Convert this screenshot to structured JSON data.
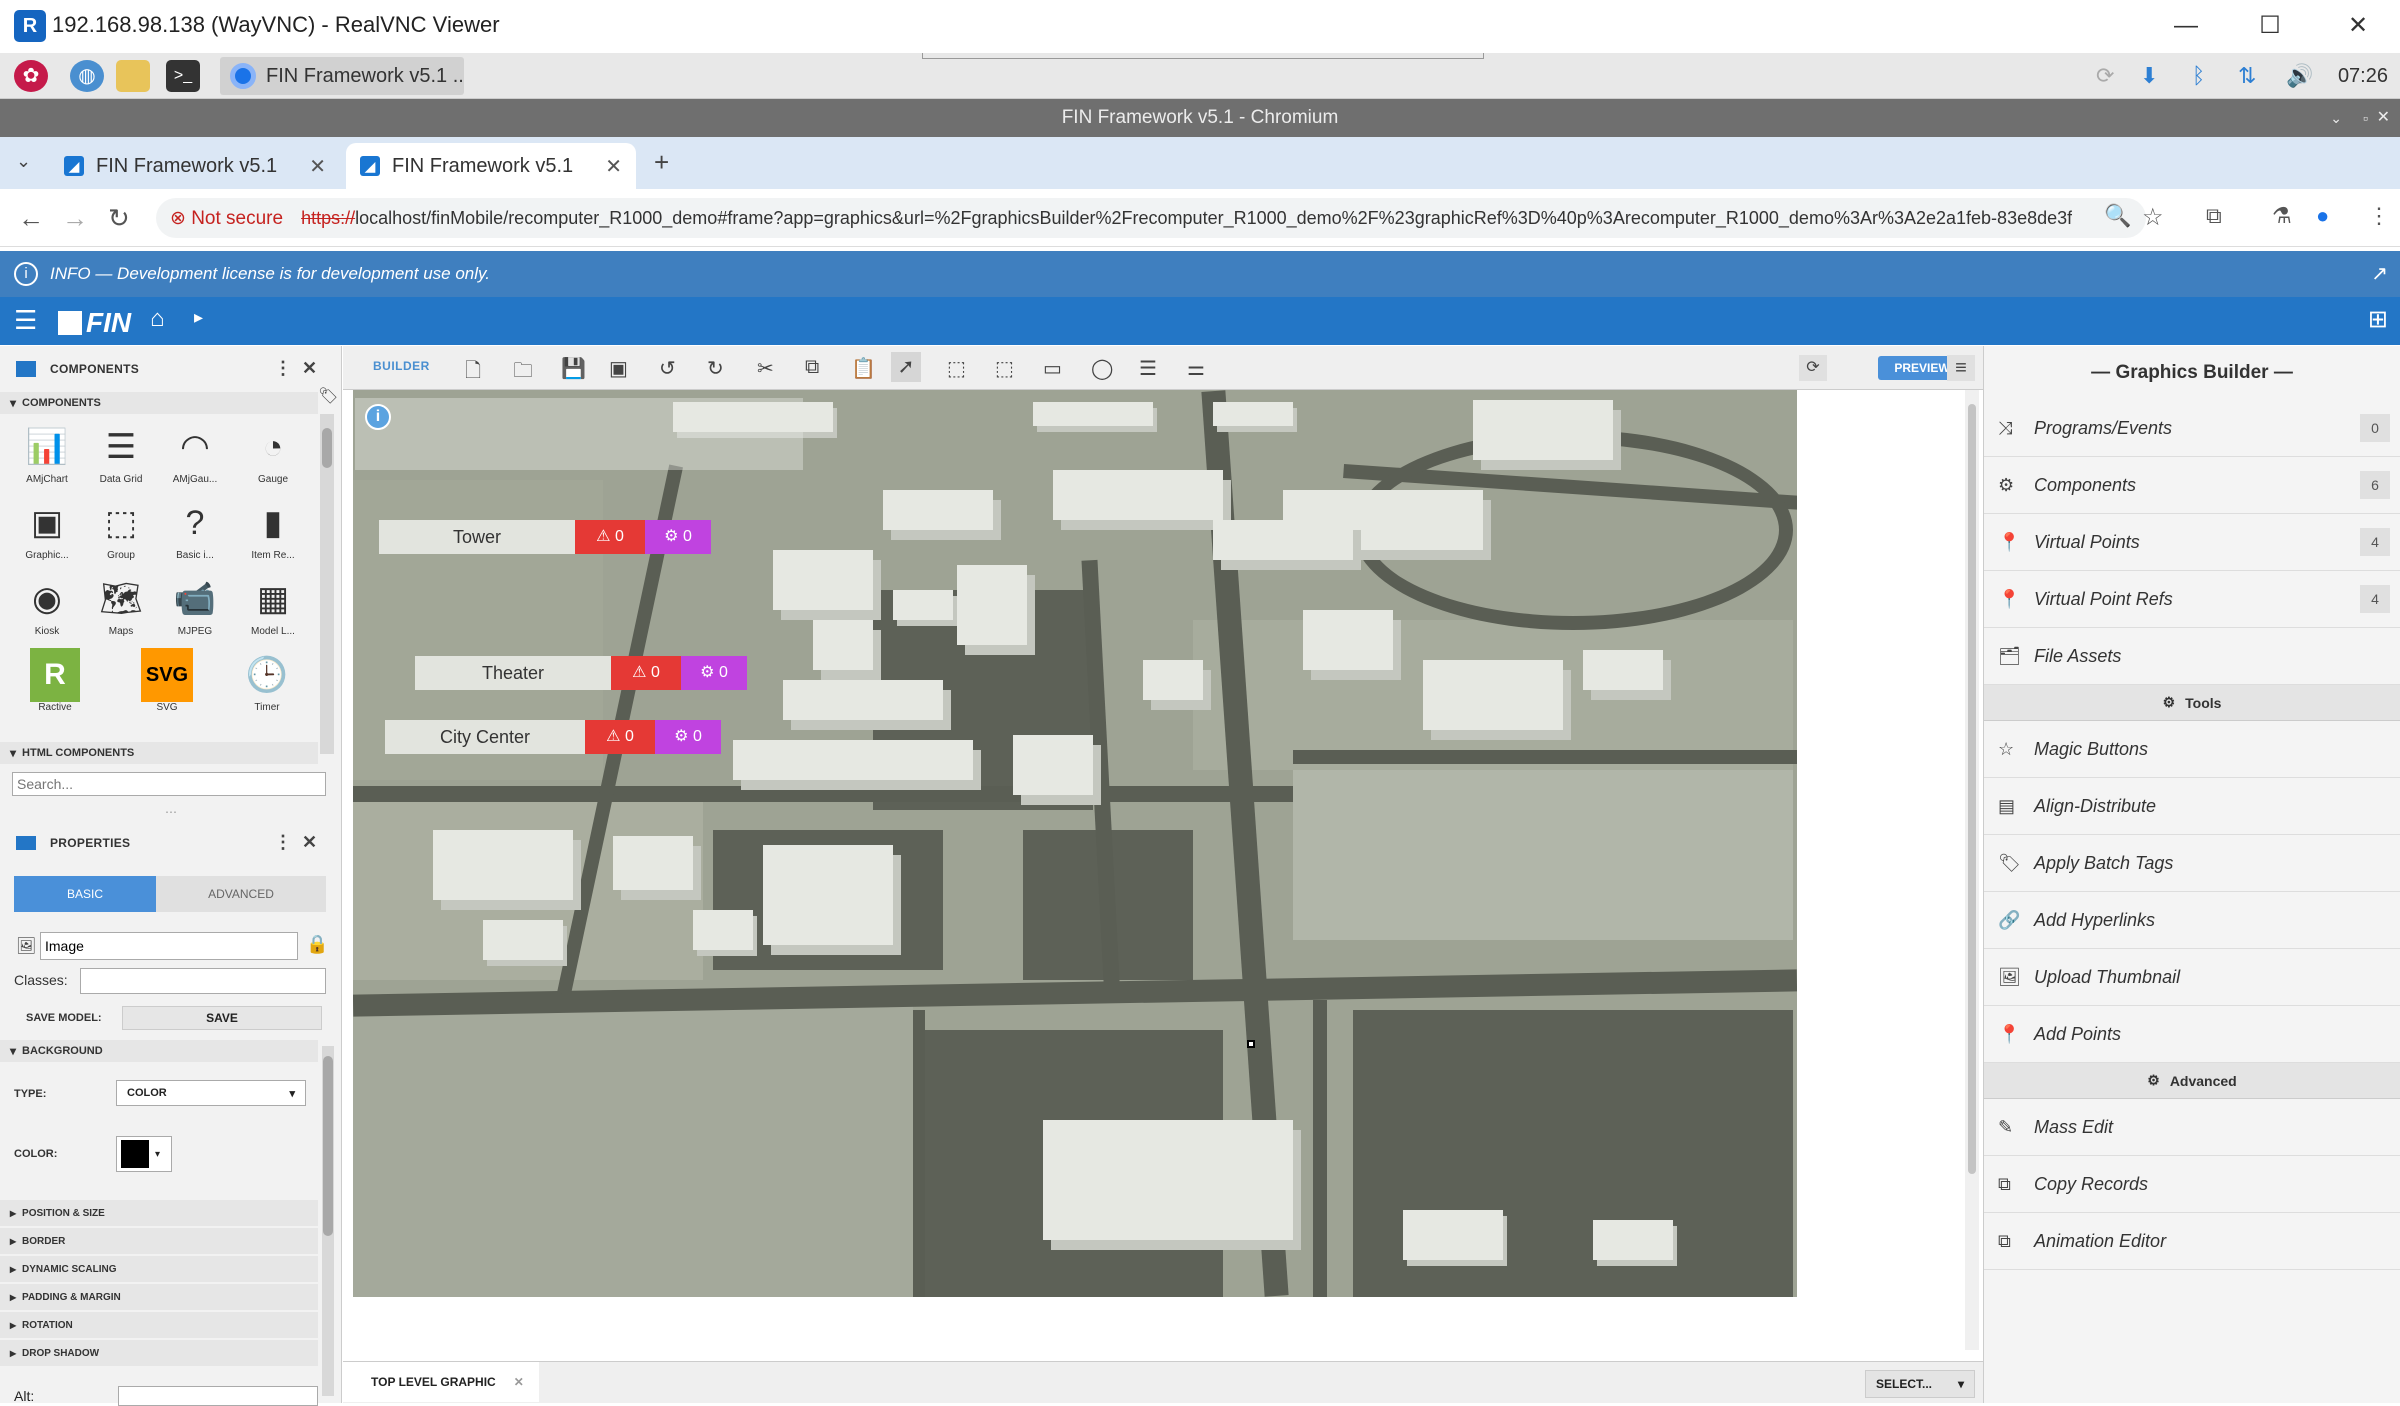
{
  "vnc": {
    "title": "192.168.98.138 (WayVNC) - RealVNC Viewer",
    "logo": "R"
  },
  "taskbar": {
    "task_label": "FIN Framework v5.1 ..",
    "clock": "07:26"
  },
  "chromium": {
    "window_title": "FIN Framework v5.1 - Chromium"
  },
  "tabs": [
    {
      "label": "FIN Framework v5.1"
    },
    {
      "label": "FIN Framework v5.1"
    }
  ],
  "address": {
    "not_secure": "Not secure",
    "scheme": "https://",
    "url": "localhost/finMobile/recomputer_R1000_demo#frame?app=graphics&url=%2FgraphicsBuilder%2Frecomputer_R1000_demo%2F%23graphicRef%3D%40p%3Arecomputer_R1000_demo%3Ar%3A2e2a1feb-83e8de3f"
  },
  "info": {
    "text": "INFO — Development license is for development use only."
  },
  "app": {
    "logo": "FIN"
  },
  "components_panel": {
    "title": "COMPONENTS",
    "section": "COMPONENTS",
    "html_section": "HTML COMPONENTS",
    "search_placeholder": "Search...",
    "items": [
      {
        "label": "AMjChart",
        "glyph": "📊"
      },
      {
        "label": "Data Grid",
        "glyph": "☰"
      },
      {
        "label": "AMjGau...",
        "glyph": "◠"
      },
      {
        "label": "Gauge",
        "glyph": "◔"
      },
      {
        "label": "Graphic...",
        "glyph": "▣"
      },
      {
        "label": "Group",
        "glyph": "⬚"
      },
      {
        "label": "Basic i...",
        "glyph": "?"
      },
      {
        "label": "Item Re...",
        "glyph": "▮"
      },
      {
        "label": "Kiosk",
        "glyph": "◉"
      },
      {
        "label": "Maps",
        "glyph": "🗺"
      },
      {
        "label": "MJPEG",
        "glyph": "📹"
      },
      {
        "label": "Model L...",
        "glyph": "▦"
      },
      {
        "label": "Ractive",
        "glyph": "R"
      },
      {
        "label": "SVG",
        "glyph": "SVG"
      },
      {
        "label": "Timer",
        "glyph": "🕒"
      }
    ]
  },
  "properties_panel": {
    "title": "PROPERTIES",
    "tab_basic": "BASIC",
    "tab_advanced": "ADVANCED",
    "name_value": "Image",
    "classes_label": "Classes:",
    "save_model_label": "SAVE MODEL:",
    "save_button": "SAVE",
    "background_section": "BACKGROUND",
    "type_label": "TYPE:",
    "type_value": "COLOR",
    "color_label": "COLOR:",
    "color_value": "#000000",
    "sections": [
      "POSITION & SIZE",
      "BORDER",
      "DYNAMIC SCALING",
      "PADDING & MARGIN",
      "ROTATION",
      "DROP SHADOW"
    ],
    "alt_label": "Alt:"
  },
  "builder": {
    "label": "BUILDER",
    "preview": "PREVIEW"
  },
  "map": {
    "locations": [
      {
        "name": "Tower",
        "alarms": "0",
        "points": "0"
      },
      {
        "name": "Theater",
        "alarms": "0",
        "points": "0"
      },
      {
        "name": "City Center",
        "alarms": "0",
        "points": "0"
      }
    ]
  },
  "bottom": {
    "tab": "TOP LEVEL GRAPHIC",
    "select": "SELECT..."
  },
  "graphics_builder": {
    "title": "— Graphics Builder —",
    "items": [
      {
        "label": "Programs/Events",
        "icon": "⤨",
        "count": "0"
      },
      {
        "label": "Components",
        "icon": "⚙",
        "count": "6"
      },
      {
        "label": "Virtual Points",
        "icon": "📍",
        "count": "4"
      },
      {
        "label": "Virtual Point Refs",
        "icon": "📍",
        "count": "4"
      },
      {
        "label": "File Assets",
        "icon": "🗂",
        "count": ""
      }
    ],
    "tools_section": "Tools",
    "tools": [
      {
        "label": "Magic Buttons",
        "icon": "☆"
      },
      {
        "label": "Align-Distribute",
        "icon": "▤"
      },
      {
        "label": "Apply Batch Tags",
        "icon": "🏷"
      },
      {
        "label": "Add Hyperlinks",
        "icon": "🔗"
      },
      {
        "label": "Upload Thumbnail",
        "icon": "🖼"
      },
      {
        "label": "Add Points",
        "icon": "📍"
      }
    ],
    "advanced_section": "Advanced",
    "advanced": [
      {
        "label": "Mass Edit",
        "icon": "✎"
      },
      {
        "label": "Copy Records",
        "icon": "⧉"
      },
      {
        "label": "Animation Editor",
        "icon": "⧉"
      }
    ]
  },
  "colors": {
    "accent": "#2376c6",
    "alarm": "#e53935",
    "points": "#c043e0"
  }
}
